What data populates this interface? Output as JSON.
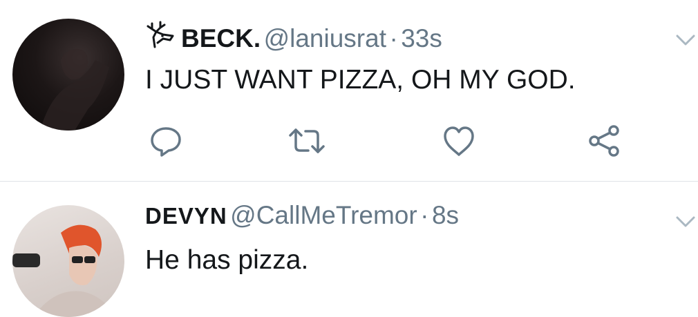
{
  "tweets": [
    {
      "author_emoji_icon": "deer-icon",
      "display_name": "BECK.",
      "handle": "@laniusrat",
      "separator": "·",
      "time": "33s",
      "text": "I JUST WANT PIZZA, OH MY GOD.",
      "actions": [
        "reply-icon",
        "retweet-icon",
        "like-icon",
        "share-icon"
      ]
    },
    {
      "display_name": "DEVYN",
      "handle": "@CallMeTremor",
      "separator": "·",
      "time": "8s",
      "text": "He has pizza."
    }
  ],
  "colors": {
    "primary_text": "#14171a",
    "secondary_text": "#657786",
    "divider": "#dfe3e7"
  }
}
